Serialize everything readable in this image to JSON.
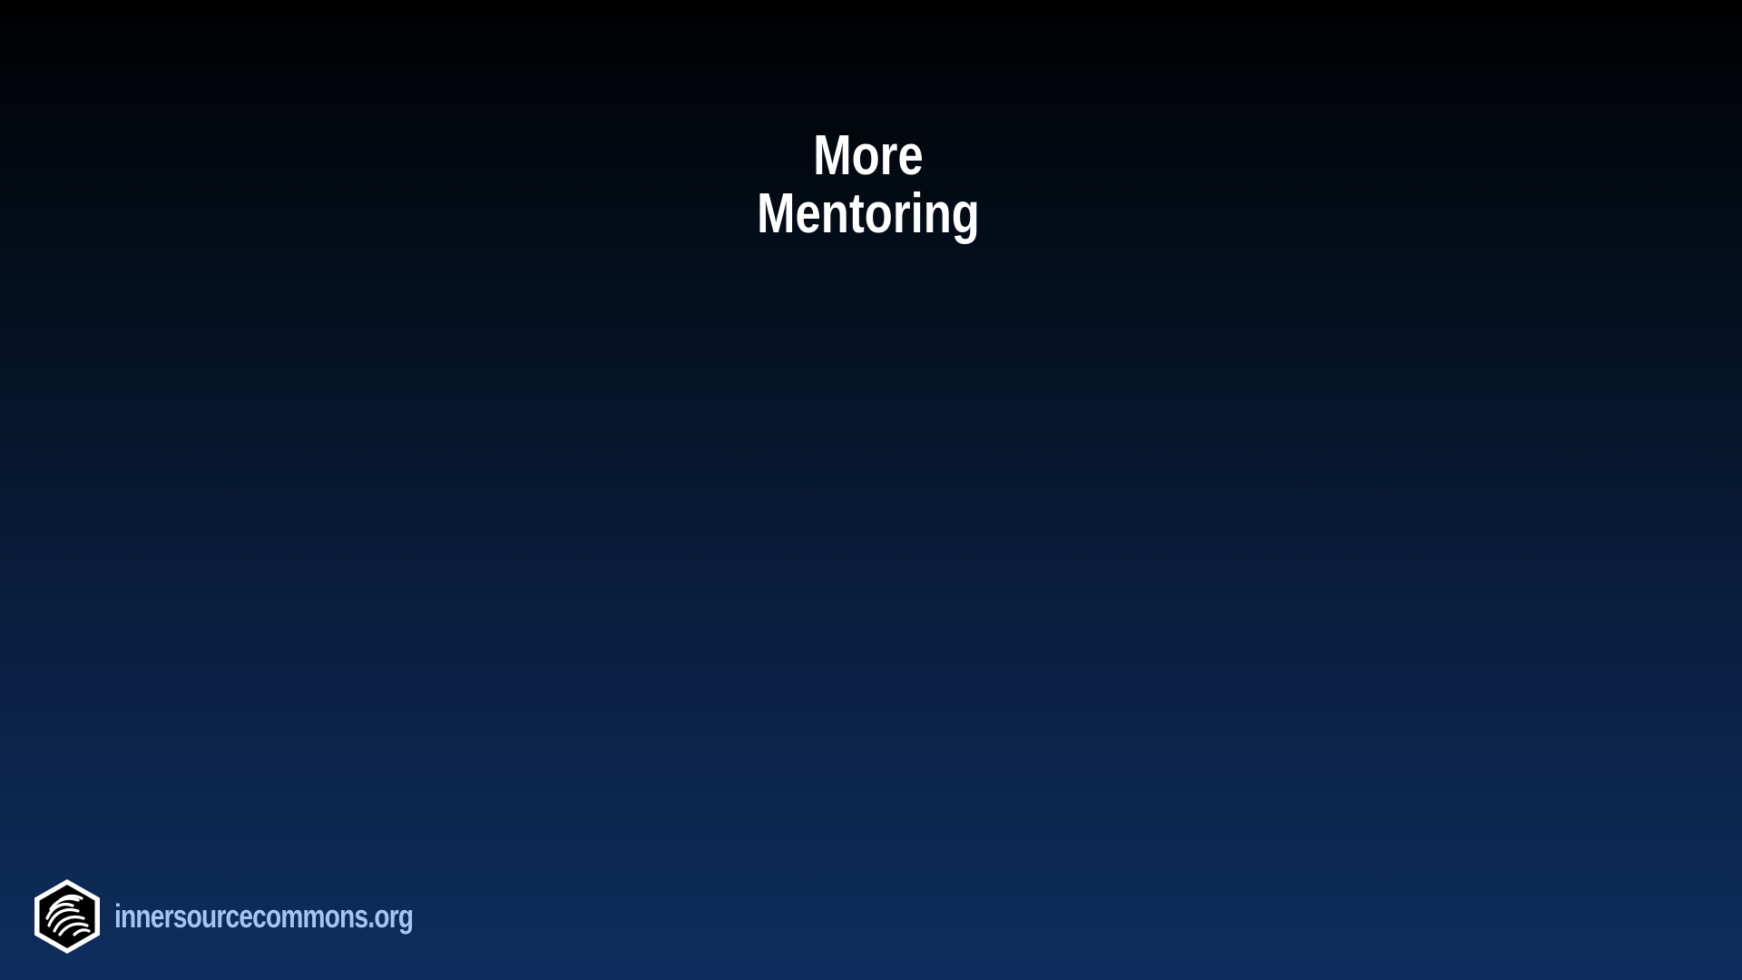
{
  "slide": {
    "title_line1": "More",
    "title_line2": "Mentoring"
  },
  "footer": {
    "logo_icon": "innersource-hexagon-logo-icon",
    "url": "innersourcecommons.org"
  },
  "colors": {
    "background_top": "#000000",
    "background_bottom": "#0e2d5e",
    "title_text": "#ffffff",
    "footer_text": "#a8c4f5"
  }
}
